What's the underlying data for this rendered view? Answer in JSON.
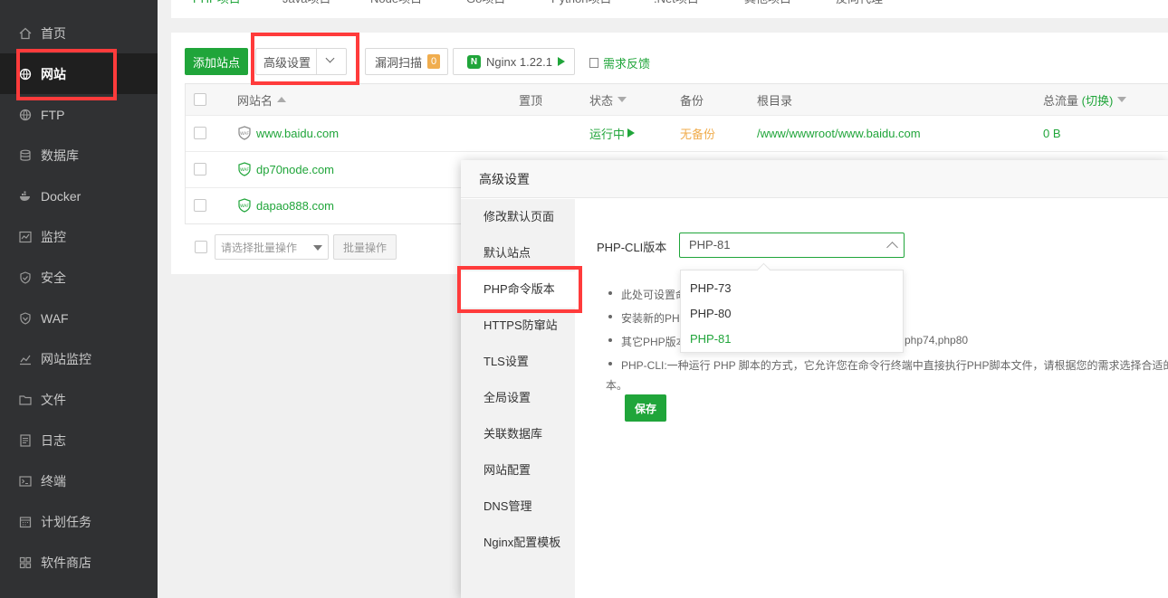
{
  "sidebar": {
    "items": [
      {
        "label": "首页",
        "icon": "home-icon"
      },
      {
        "label": "网站",
        "icon": "globe-icon",
        "active": true
      },
      {
        "label": "FTP",
        "icon": "globe-icon"
      },
      {
        "label": "数据库",
        "icon": "database-icon"
      },
      {
        "label": "Docker",
        "icon": "docker-icon"
      },
      {
        "label": "监控",
        "icon": "monitor-icon"
      },
      {
        "label": "安全",
        "icon": "shield-icon"
      },
      {
        "label": "WAF",
        "icon": "waf-shield-icon"
      },
      {
        "label": "网站监控",
        "icon": "chart-icon"
      },
      {
        "label": "文件",
        "icon": "folder-icon"
      },
      {
        "label": "日志",
        "icon": "log-icon"
      },
      {
        "label": "终端",
        "icon": "terminal-icon"
      },
      {
        "label": "计划任务",
        "icon": "calendar-icon"
      },
      {
        "label": "软件商店",
        "icon": "store-icon"
      }
    ]
  },
  "tabs": [
    "PHP项目",
    "Java项目",
    "Node项目",
    "Go项目",
    "Python项目",
    ".Net项目",
    "其他项目",
    "反向代理"
  ],
  "toolbar": {
    "add_site": "添加站点",
    "advanced": "高级设置",
    "vuln_scan": "漏洞扫描",
    "vuln_count": "0",
    "nginx": "Nginx 1.22.1",
    "feedback": "需求反馈"
  },
  "table": {
    "headers": {
      "name": "网站名",
      "top": "置顶",
      "status": "状态",
      "backup": "备份",
      "root": "根目录",
      "traffic": "总流量",
      "traffic_toggle": "(切换)"
    },
    "rows": [
      {
        "name": "www.baidu.com",
        "status": "运行中",
        "backup": "无备份",
        "root": "/www/wwwroot/www.baidu.com",
        "traffic": "0 B"
      },
      {
        "name": "dp70node.com"
      },
      {
        "name": "dapao888.com"
      }
    ]
  },
  "batch": {
    "select_placeholder": "请选择批量操作",
    "button": "批量操作"
  },
  "modal": {
    "title": "高级设置",
    "menu": [
      "修改默认页面",
      "默认站点",
      "PHP命令版本",
      "HTTPS防窜站",
      "TLS设置",
      "全局设置",
      "关联数据库",
      "网站配置",
      "DNS管理",
      "Nginx配置模板"
    ],
    "php_cli_label": "PHP-CLI版本",
    "php_selected": "PHP-81",
    "options": [
      "PHP-73",
      "PHP-80",
      "PHP-81"
    ],
    "notes": [
      "此处可设置命",
      "安装新的PHP",
      "其它PHP版本",
      "php74,php80",
      "PHP-CLI:一种运行 PHP 脚本的方式，它允许您在命令行终端中直接执行PHP脚本文件，请根据您的需求选择合适的",
      "本。"
    ],
    "save": "保存"
  },
  "colors": {
    "accent": "#20a53a",
    "sidebar_bg": "#303133",
    "highlight": "#ff3b3b",
    "warning": "#f0ad4e"
  }
}
